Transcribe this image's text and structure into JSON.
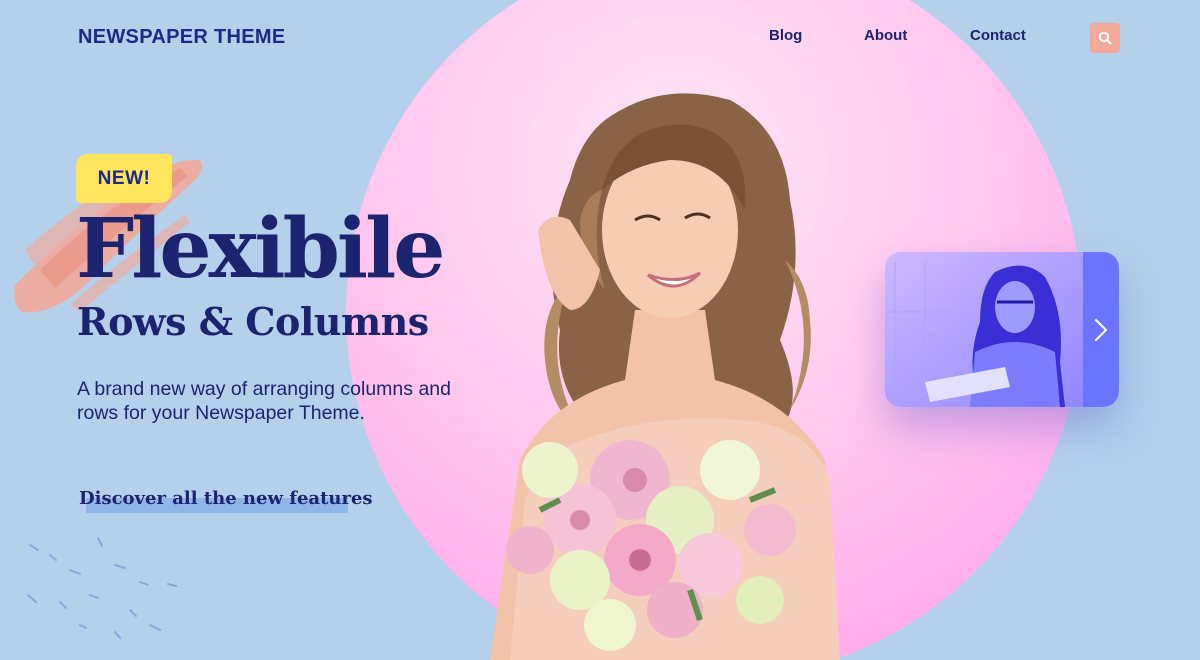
{
  "header": {
    "logo": "NEWSPAPER THEME",
    "nav": [
      "Blog",
      "About",
      "Contact"
    ],
    "search_icon": "search-icon"
  },
  "hero": {
    "badge": "NEW!",
    "headline": "Flexibile",
    "subheadline": "Rows & Columns",
    "description": "A brand new way of arranging columns and rows for your Newspaper Theme.",
    "cta": "Discover all the new features"
  },
  "slider": {
    "next_icon": "chevron-right-icon"
  },
  "colors": {
    "background": "#b5d0ea",
    "navy": "#1c2470",
    "pink_circle": "#ff9ce8",
    "badge_yellow": "#ffe55c",
    "brush_coral": "#f3a99a",
    "accent_purple": "#6a74ff"
  }
}
